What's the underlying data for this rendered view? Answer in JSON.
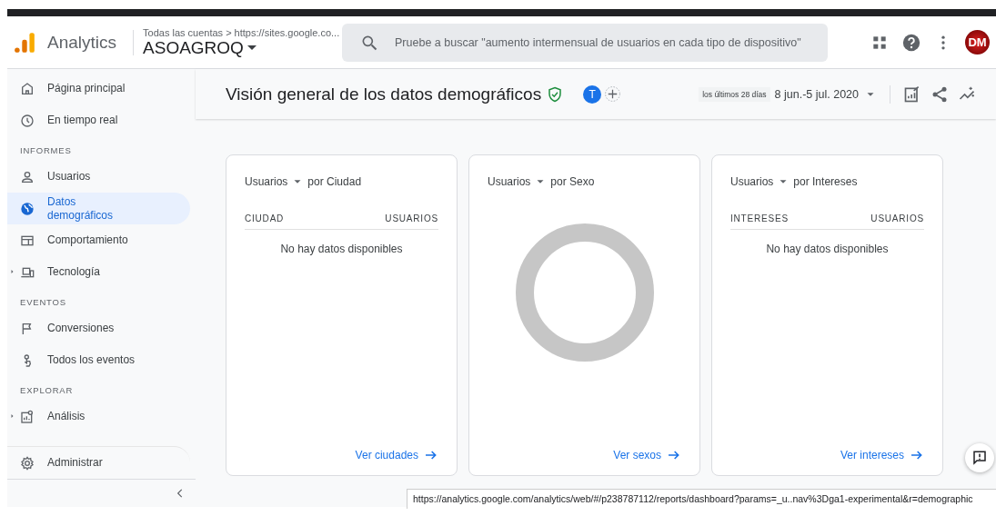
{
  "header": {
    "app_name": "Analytics",
    "breadcrumb": "Todas las cuentas > https://sites.google.co...",
    "property": "ASOAGROQ",
    "search_placeholder": "Pruebe a buscar \"aumento intermensual de usuarios en cada tipo de dispositivo\"",
    "avatar": "DM"
  },
  "sidebar": {
    "items": [
      {
        "kind": "item",
        "label": "Página principal",
        "selected": false,
        "expandable": false
      },
      {
        "kind": "item",
        "label": "En tiempo real",
        "selected": false,
        "expandable": false
      },
      {
        "kind": "section",
        "label": "INFORMES"
      },
      {
        "kind": "item",
        "label": "Usuarios",
        "selected": false,
        "expandable": false
      },
      {
        "kind": "item",
        "label": "Datos demográficos",
        "selected": true,
        "expandable": false
      },
      {
        "kind": "item",
        "label": "Comportamiento",
        "selected": false,
        "expandable": false
      },
      {
        "kind": "item",
        "label": "Tecnología",
        "selected": false,
        "expandable": true
      },
      {
        "kind": "section",
        "label": "EVENTOS"
      },
      {
        "kind": "item",
        "label": "Conversiones",
        "selected": false,
        "expandable": false
      },
      {
        "kind": "item",
        "label": "Todos los eventos",
        "selected": false,
        "expandable": false
      },
      {
        "kind": "section",
        "label": "EXPLORAR"
      },
      {
        "kind": "item",
        "label": "Análisis",
        "selected": false,
        "expandable": true
      }
    ],
    "footer_item": {
      "label": "Administrar"
    }
  },
  "page": {
    "title": "Visión general de los datos demográficos",
    "comparison_badge": "T",
    "range_label": "los últimos 28 días",
    "date_range": "8 jun.-5 jul. 2020"
  },
  "cards": [
    {
      "kind": "table",
      "metric": "Usuarios",
      "dimension": "por Ciudad",
      "columns": [
        "CIUDAD",
        "USUARIOS"
      ],
      "empty_message": "No hay datos disponibles",
      "link": "Ver ciudades"
    },
    {
      "kind": "donut",
      "metric": "Usuarios",
      "dimension": "por Sexo",
      "link": "Ver sexos"
    },
    {
      "kind": "table",
      "metric": "Usuarios",
      "dimension": "por Intereses",
      "columns": [
        "INTERESES",
        "USUARIOS"
      ],
      "empty_message": "No hay datos disponibles",
      "link": "Ver intereses"
    }
  ],
  "status_url": "https://analytics.google.com/analytics/web/#/p238787112/reports/dashboard?params=_u..nav%3Dga1-experimental&r=demographic"
}
